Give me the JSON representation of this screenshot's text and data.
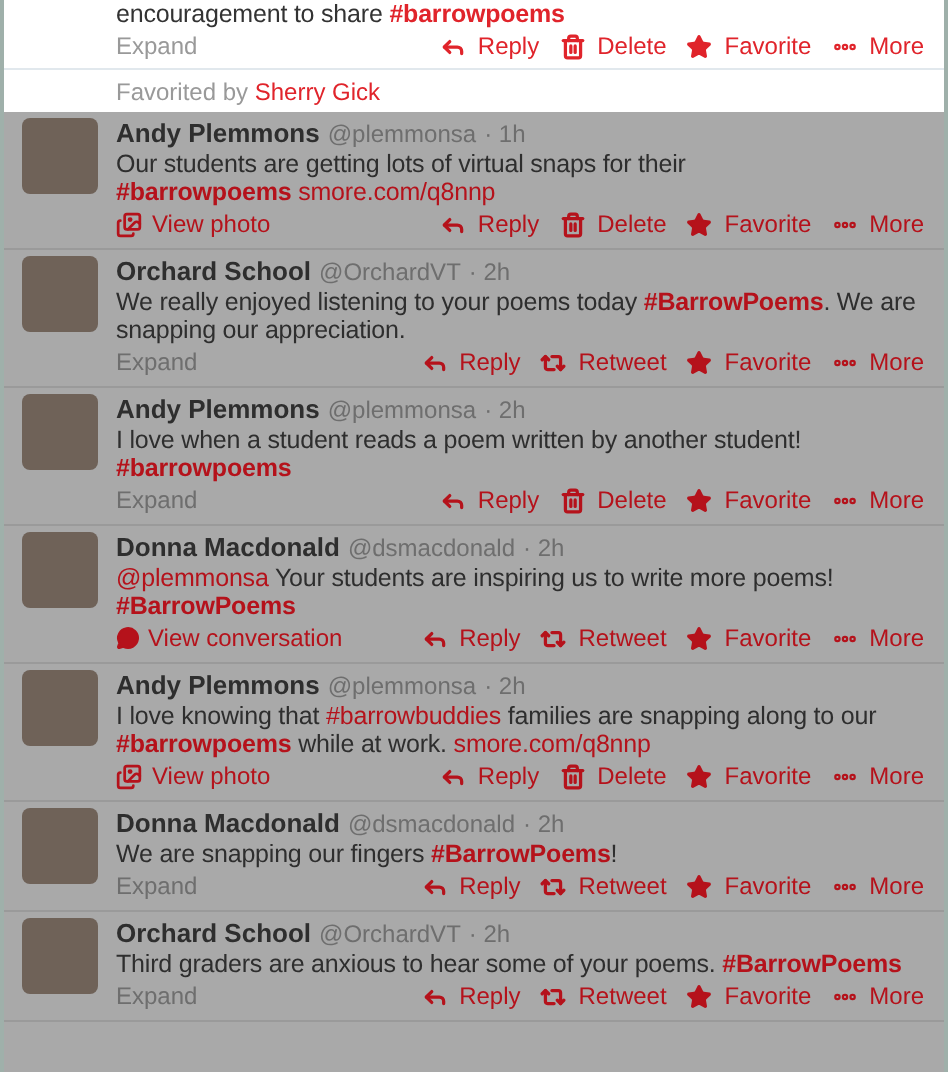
{
  "expanded_tweet": {
    "body": [
      {
        "kind": "text",
        "text": "encouragement to share "
      },
      {
        "kind": "hashtag",
        "text": "#barrowpoems"
      }
    ],
    "footer": {
      "kind": "expand",
      "label": "Expand"
    },
    "actions": [
      {
        "kind": "reply",
        "label": "Reply"
      },
      {
        "kind": "delete",
        "label": "Delete"
      },
      {
        "kind": "favorite",
        "label": "Favorite"
      },
      {
        "kind": "more",
        "label": "More"
      }
    ],
    "favorited_by": {
      "label": "Favorited by",
      "name": "Sherry Gick"
    }
  },
  "timeline": [
    {
      "name": "Andy Plemmons",
      "handle": "@plemmonsa",
      "time": "· 1h",
      "body": [
        {
          "kind": "text",
          "text": "Our students are getting lots of virtual snaps for their "
        },
        {
          "kind": "hashtag",
          "text": "#barrowpoems "
        },
        {
          "kind": "link",
          "text": "smore.com/q8nnp"
        }
      ],
      "footer": {
        "kind": "photo",
        "label": "View photo"
      },
      "actions": [
        {
          "kind": "reply",
          "label": "Reply"
        },
        {
          "kind": "delete",
          "label": "Delete"
        },
        {
          "kind": "favorite",
          "label": "Favorite"
        },
        {
          "kind": "more",
          "label": "More"
        }
      ]
    },
    {
      "name": "Orchard School",
      "handle": "@OrchardVT",
      "time": "· 2h",
      "body": [
        {
          "kind": "text",
          "text": "We really enjoyed listening to your poems today "
        },
        {
          "kind": "hashtag",
          "text": "#BarrowPoems"
        },
        {
          "kind": "text",
          "text": ". We are snapping our appreciation."
        }
      ],
      "footer": {
        "kind": "expand",
        "label": "Expand"
      },
      "actions": [
        {
          "kind": "reply",
          "label": "Reply"
        },
        {
          "kind": "retweet",
          "label": "Retweet"
        },
        {
          "kind": "favorite",
          "label": "Favorite"
        },
        {
          "kind": "more",
          "label": "More"
        }
      ]
    },
    {
      "name": "Andy Plemmons",
      "handle": "@plemmonsa",
      "time": "· 2h",
      "body": [
        {
          "kind": "text",
          "text": "I love when a student reads a poem written by another student! "
        },
        {
          "kind": "hashtag",
          "text": "#barrowpoems"
        }
      ],
      "footer": {
        "kind": "expand",
        "label": "Expand"
      },
      "actions": [
        {
          "kind": "reply",
          "label": "Reply"
        },
        {
          "kind": "delete",
          "label": "Delete"
        },
        {
          "kind": "favorite",
          "label": "Favorite"
        },
        {
          "kind": "more",
          "label": "More"
        }
      ]
    },
    {
      "name": "Donna Macdonald",
      "handle": "@dsmacdonald",
      "time": "· 2h",
      "body": [
        {
          "kind": "mention",
          "text": "@plemmonsa"
        },
        {
          "kind": "text",
          "text": " Your students are inspiring us to write more poems! "
        },
        {
          "kind": "hashtag",
          "text": "#BarrowPoems"
        }
      ],
      "footer": {
        "kind": "conversation",
        "label": "View conversation"
      },
      "actions": [
        {
          "kind": "reply",
          "label": "Reply"
        },
        {
          "kind": "retweet",
          "label": "Retweet"
        },
        {
          "kind": "favorite",
          "label": "Favorite"
        },
        {
          "kind": "more",
          "label": "More"
        }
      ]
    },
    {
      "name": "Andy Plemmons",
      "handle": "@plemmonsa",
      "time": "· 2h",
      "body": [
        {
          "kind": "text",
          "text": "I love knowing that "
        },
        {
          "kind": "hashtag_plain",
          "text": "#barrowbuddies"
        },
        {
          "kind": "text",
          "text": " families are snapping along to our "
        },
        {
          "kind": "hashtag",
          "text": "#barrowpoems"
        },
        {
          "kind": "text",
          "text": " while at work. "
        },
        {
          "kind": "link",
          "text": "smore.com/q8nnp"
        }
      ],
      "footer": {
        "kind": "photo",
        "label": "View photo"
      },
      "actions": [
        {
          "kind": "reply",
          "label": "Reply"
        },
        {
          "kind": "delete",
          "label": "Delete"
        },
        {
          "kind": "favorite",
          "label": "Favorite"
        },
        {
          "kind": "more",
          "label": "More"
        }
      ]
    },
    {
      "name": "Donna Macdonald",
      "handle": "@dsmacdonald",
      "time": "· 2h",
      "body": [
        {
          "kind": "text",
          "text": "We are snapping our fingers "
        },
        {
          "kind": "hashtag",
          "text": "#BarrowPoems"
        },
        {
          "kind": "text",
          "text": "!"
        }
      ],
      "footer": {
        "kind": "expand",
        "label": "Expand"
      },
      "actions": [
        {
          "kind": "reply",
          "label": "Reply"
        },
        {
          "kind": "retweet",
          "label": "Retweet"
        },
        {
          "kind": "favorite",
          "label": "Favorite"
        },
        {
          "kind": "more",
          "label": "More"
        }
      ]
    },
    {
      "name": "Orchard School",
      "handle": "@OrchardVT",
      "time": "· 2h",
      "body": [
        {
          "kind": "text",
          "text": "Third graders are anxious to hear some of your poems. "
        },
        {
          "kind": "hashtag",
          "text": "#BarrowPoems"
        }
      ],
      "footer": {
        "kind": "expand",
        "label": "Expand"
      },
      "actions": [
        {
          "kind": "reply",
          "label": "Reply"
        },
        {
          "kind": "retweet",
          "label": "Retweet"
        },
        {
          "kind": "favorite",
          "label": "Favorite"
        },
        {
          "kind": "more",
          "label": "More"
        }
      ]
    }
  ]
}
